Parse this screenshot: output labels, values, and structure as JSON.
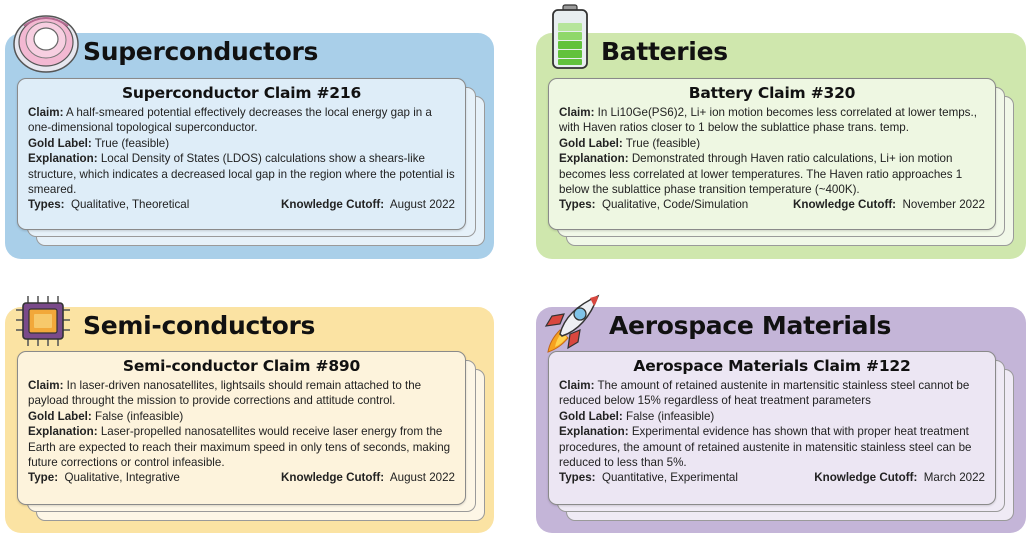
{
  "panels": [
    {
      "heading": "Superconductors",
      "icon": "superconductor-coil-icon",
      "colors": {
        "panel": "#a9cfe9",
        "card": "#deedf8",
        "stack": "#e6f1f9"
      },
      "card": {
        "title": "Superconductor Claim #216",
        "claim_label": "Claim:",
        "claim": "A half-smeared potential effectively decreases the local energy gap in a one-dimensional topological superconductor.",
        "gold_label": "Gold Label:",
        "gold": "True (feasible)",
        "explanation_label": "Explanation:",
        "explanation": "Local Density of States (LDOS) calculations show a shears-like structure, which indicates a decreased local gap in the region where the potential is smeared.",
        "types_label": "Types:",
        "types": "Qualitative, Theoretical",
        "cutoff_label": "Knowledge Cutoff:",
        "cutoff": "August 2022"
      }
    },
    {
      "heading": "Batteries",
      "icon": "battery-icon",
      "colors": {
        "panel": "#cfe7ad",
        "card": "#eef7e2",
        "stack": "#f1f8e8"
      },
      "card": {
        "title": "Battery Claim #320",
        "claim_label": "Claim:",
        "claim": "In Li10Ge(PS6)2, Li+ ion motion becomes less correlated at lower temps., with Haven ratios closer to 1 below the sublattice phase trans. temp.",
        "gold_label": "Gold Label:",
        "gold": "True (feasible)",
        "explanation_label": "Explanation:",
        "explanation": "Demonstrated through Haven ratio calculations, Li+ ion motion becomes less correlated at lower temperatures. The Haven ratio approaches 1 below the sublattice phase transition temperature (~400K).",
        "types_label": "Types:",
        "types": "Qualitative, Code/Simulation",
        "cutoff_label": "Knowledge Cutoff:",
        "cutoff": "November 2022"
      }
    },
    {
      "heading": "Semi-conductors",
      "icon": "microchip-icon",
      "colors": {
        "panel": "#fbe3a3",
        "card": "#fdf3dc",
        "stack": "#fdf6e6"
      },
      "card": {
        "title": "Semi-conductor Claim #890",
        "claim_label": "Claim:",
        "claim": "In laser-driven nanosatellites, lightsails should remain attached to the payload throught the mission to provide corrections and attitude control.",
        "gold_label": "Gold Label:",
        "gold": "False (infeasible)",
        "explanation_label": "Explanation:",
        "explanation": "Laser-propelled nanosatellites would receive laser energy from the Earth are expected to reach their maximum speed in only tens of seconds, making future corrections or control infeasible.",
        "types_label": "Type:",
        "types": "Qualitative, Integrative",
        "cutoff_label": "Knowledge Cutoff:",
        "cutoff": "August 2022"
      }
    },
    {
      "heading": "Aerospace Materials",
      "icon": "rocket-icon",
      "colors": {
        "panel": "#c4b5d8",
        "card": "#ece6f3",
        "stack": "#efeaf5"
      },
      "card": {
        "title": "Aerospace Materials Claim #122",
        "claim_label": "Claim:",
        "claim": "The amount of retained austenite in martensitic stainless steel cannot be reduced below 15% regardless of heat treatment parameters",
        "gold_label": "Gold Label:",
        "gold": "False (infeasible)",
        "explanation_label": "Explanation:",
        "explanation": "Experimental evidence has shown that with proper heat treatment procedures, the amount of retained austenite in matensitic stainless steel can be reduced to less than 5%.",
        "types_label": "Types:",
        "types": "Quantitative, Experimental",
        "cutoff_label": "Knowledge Cutoff:",
        "cutoff": "March 2022"
      }
    }
  ]
}
